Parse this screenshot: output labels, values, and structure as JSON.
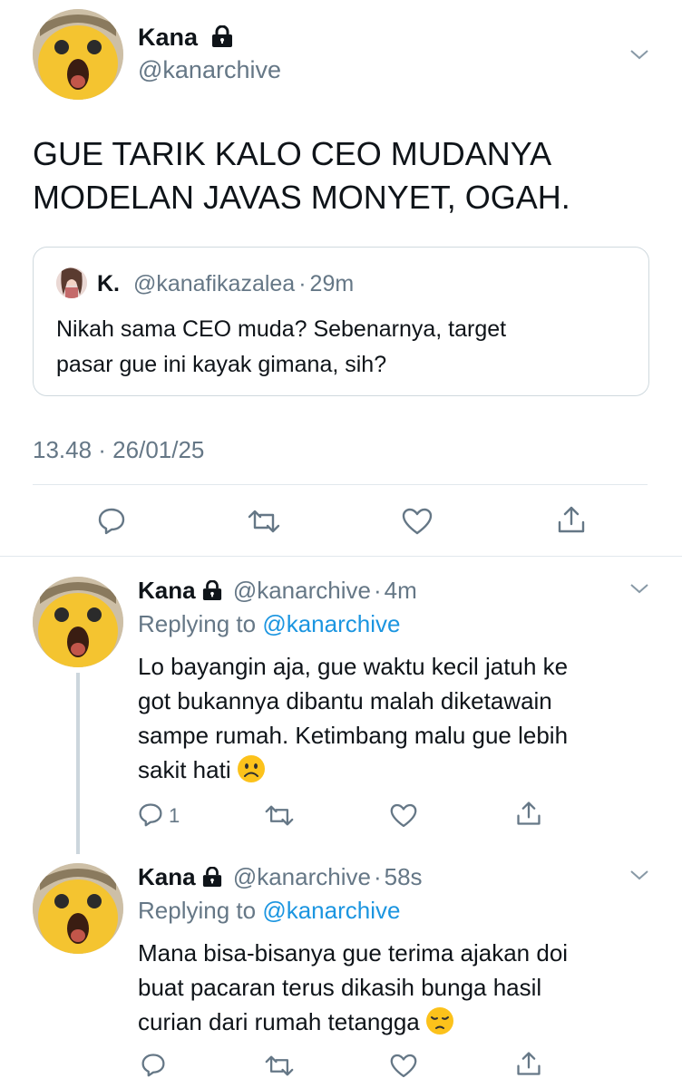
{
  "main_tweet": {
    "name": "Kana",
    "handle": "@kanarchive",
    "text_line1": "GUE TARIK KALO CEO MUDANYA",
    "text_line2": "MODELAN JAVAS MONYET, OGAH.",
    "quote": {
      "name": "K.",
      "handle": "@kanafikazalea",
      "separator": "·",
      "time": "29m",
      "text_line1": "Nikah sama CEO muda? Sebenarnya, target",
      "text_line2": "pasar gue ini kayak gimana, sih?"
    },
    "timestamp": "13.48 · 26/01/25"
  },
  "replies": [
    {
      "name": "Kana",
      "handle": "@kanarchive",
      "separator": "·",
      "time": "4m",
      "replying_prefix": "Replying to ",
      "replying_to": "@kanarchive",
      "lines": [
        "Lo bayangin aja, gue waktu kecil jatuh ke",
        "got bukannya dibantu malah diketawain",
        "sampe rumah. Ketimbang malu gue lebih",
        "sakit hati"
      ],
      "emoji": "frowning-face",
      "reply_count": "1"
    },
    {
      "name": "Kana",
      "handle": "@kanarchive",
      "separator": "·",
      "time": "58s",
      "replying_prefix": "Replying to ",
      "replying_to": "@kanarchive",
      "lines": [
        "Mana bisa-bisanya gue terima ajakan doi",
        "buat pacaran terus dikasih bunga hasil",
        "curian dari rumah tetangga"
      ],
      "emoji": "pensive-face",
      "reply_count": ""
    }
  ],
  "colors": {
    "text": "#0f1419",
    "secondary": "#657786",
    "link": "#1b95e0",
    "divider": "#e1e8ed"
  },
  "icons": [
    "lock-icon",
    "chevron-down-icon",
    "reply-icon",
    "retweet-icon",
    "like-icon",
    "share-icon"
  ]
}
